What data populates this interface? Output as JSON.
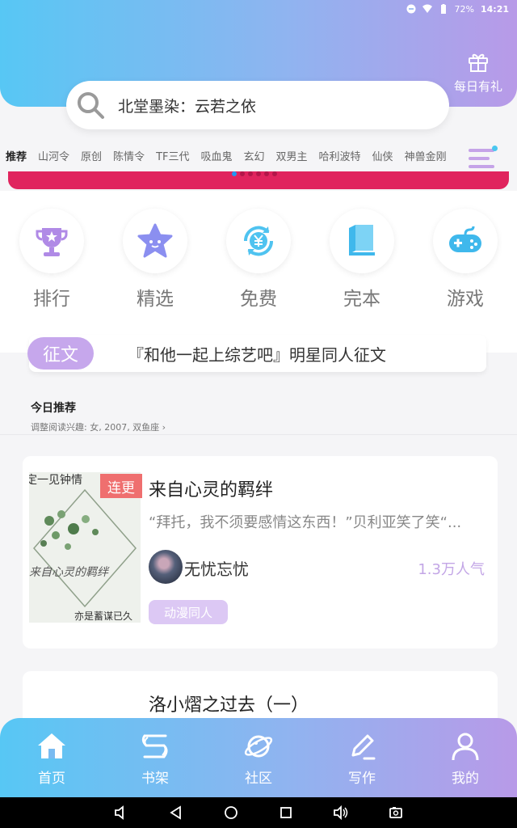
{
  "status_bar": {
    "battery": "72%",
    "time": "14:21"
  },
  "gift": {
    "label": "每日有礼",
    "icon": "gift-icon"
  },
  "search": {
    "text": "北堂墨染：云若之依",
    "icon": "search-icon"
  },
  "tabs": [
    "推荐",
    "山河令",
    "原创",
    "陈情令",
    "TF三代",
    "吸血鬼",
    "玄幻",
    "双男主",
    "哈利波特",
    "仙侠",
    "神兽金刚"
  ],
  "quick_nav": [
    {
      "label": "排行",
      "icon": "trophy-icon"
    },
    {
      "label": "精选",
      "icon": "star-icon"
    },
    {
      "label": "免费",
      "icon": "yen-coin-icon"
    },
    {
      "label": "完本",
      "icon": "book-icon"
    },
    {
      "label": "游戏",
      "icon": "gamepad-icon"
    }
  ],
  "essay": {
    "badge": "征文",
    "text": "『和他一起上综艺吧』明星同人征文"
  },
  "recommend": {
    "title": "今日推荐",
    "subtitle": "调整阅读兴趣: 女, 2007, 双鱼座 ›"
  },
  "books": [
    {
      "ribbon": "连更",
      "title": "来自心灵的羁绊",
      "desc": "“拜托，我不须要感情这东西！”贝利亚笑了笑“...",
      "author": "无忧忘忧",
      "popularity": "1.3万人气",
      "tag": "动漫同人",
      "cover_text_top": "定一见钟情",
      "cover_text_mid": "来自心灵的羁绊",
      "cover_text_bottom": "亦是蓄谋已久"
    },
    {
      "title": "洛小熠之过去（一）"
    }
  ],
  "bottom_nav": [
    {
      "label": "首页",
      "icon": "home-icon"
    },
    {
      "label": "书架",
      "icon": "bookshelf-icon"
    },
    {
      "label": "社区",
      "icon": "planet-icon"
    },
    {
      "label": "写作",
      "icon": "pen-icon"
    },
    {
      "label": "我的",
      "icon": "user-icon"
    }
  ],
  "colors": {
    "gradient_start": "#57c7f4",
    "gradient_end": "#b89ae8",
    "accent_purple": "#c6a7ec",
    "ribbon_red": "#ef6f6f",
    "banner_red": "#e0245e"
  }
}
